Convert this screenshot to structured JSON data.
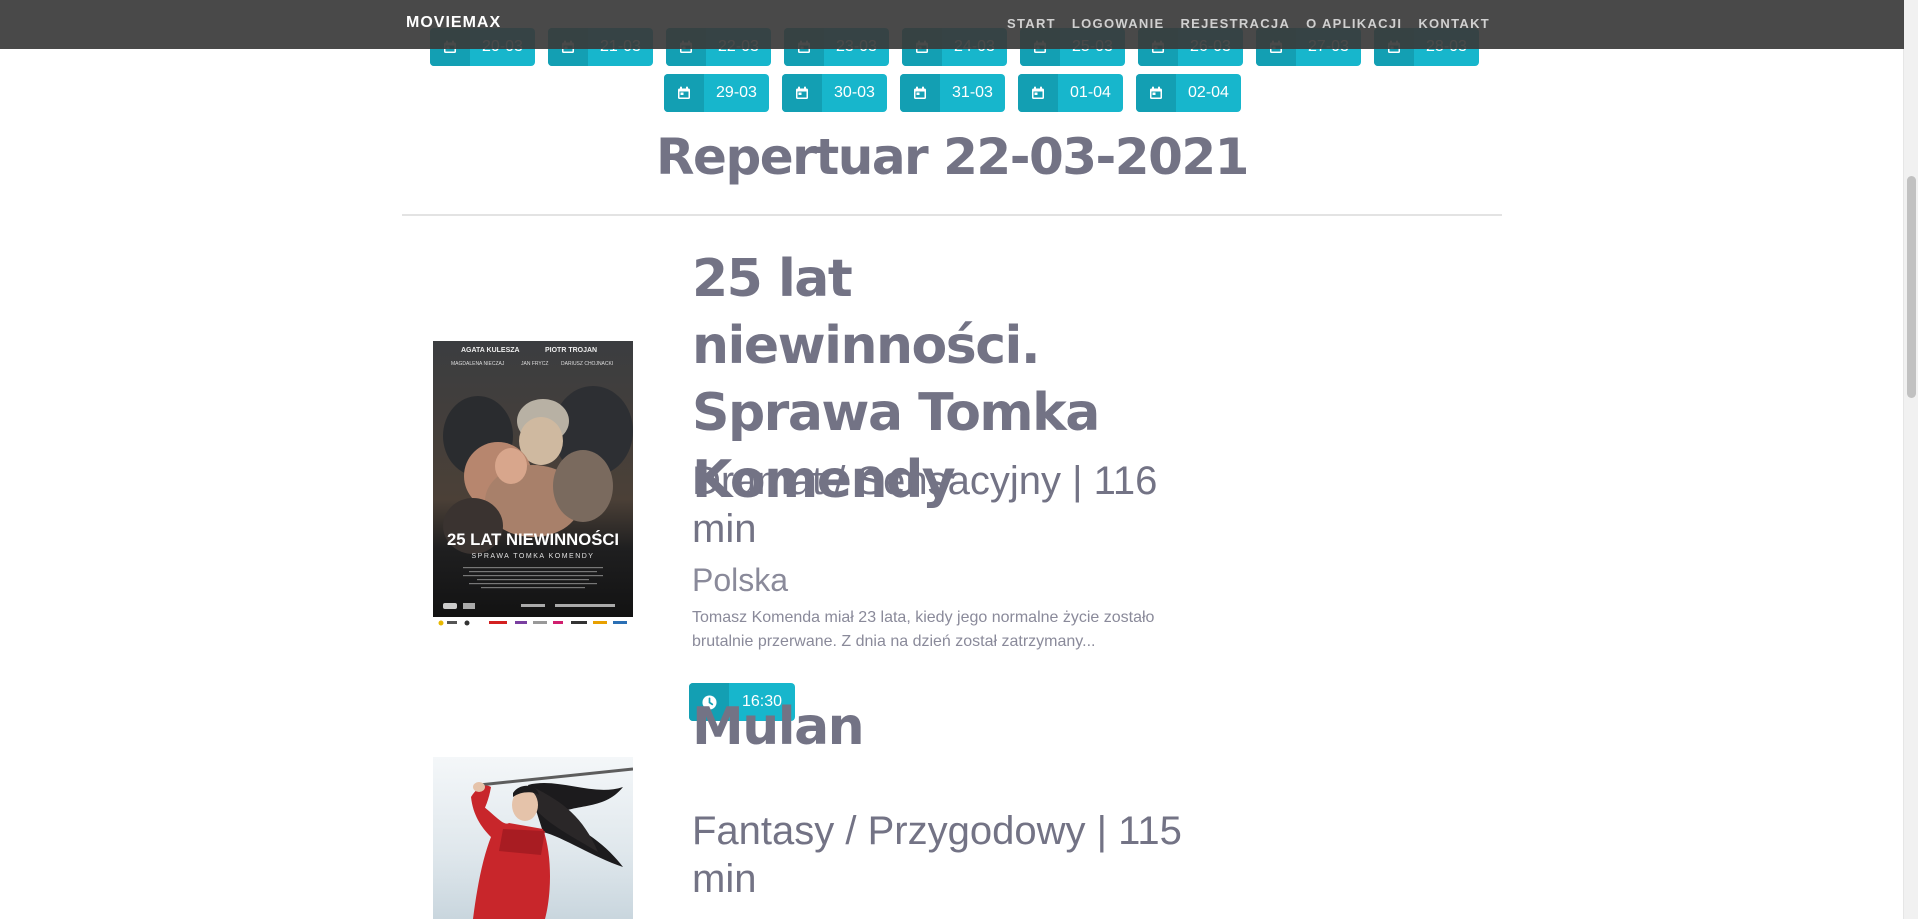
{
  "navbar": {
    "brand": "MOVIEMAX",
    "links": [
      "START",
      "LOGOWANIE",
      "REJESTRACJA",
      "O APLIKACJI",
      "KONTAKT"
    ]
  },
  "dates": {
    "row1": [
      "20-03",
      "21-03",
      "22-03",
      "23-03",
      "24-03",
      "25-03",
      "26-03",
      "27-03",
      "28-03"
    ],
    "row2": [
      "29-03",
      "30-03",
      "31-03",
      "01-04",
      "02-04"
    ]
  },
  "repertoire": {
    "title": "Repertuar 22-03-2021"
  },
  "movies": [
    {
      "title": "25 lat niewinności. Sprawa Tomka Komendy",
      "genre": "Dramat / Sensacyjny | 116 min",
      "country": "Polska",
      "description": "Tomasz Komenda miał 23 lata, kiedy jego normalne życie zostało brutalnie przerwane. Z dnia na dzień został zatrzymany...",
      "poster_credits": [
        "AGATA KULESZA",
        "PIOTR TROJAN",
        "MAGDALENA NIECZAJ",
        "JAN FRYCZ",
        "DARIUSZ CHOJNACKI"
      ],
      "poster_title": "25 LAT NIEWINNOŚCI",
      "poster_subtitle": "SPRAWA TOMKA KOMENDY",
      "times": [
        "16:30"
      ]
    },
    {
      "title": "Mulan",
      "genre": "Fantasy / Przygodowy | 115 min"
    }
  ],
  "colors": {
    "accent": "#17b6cc",
    "accent_dark": "#139fb3",
    "text": "#737385",
    "navbar": "#3a3a3a"
  }
}
